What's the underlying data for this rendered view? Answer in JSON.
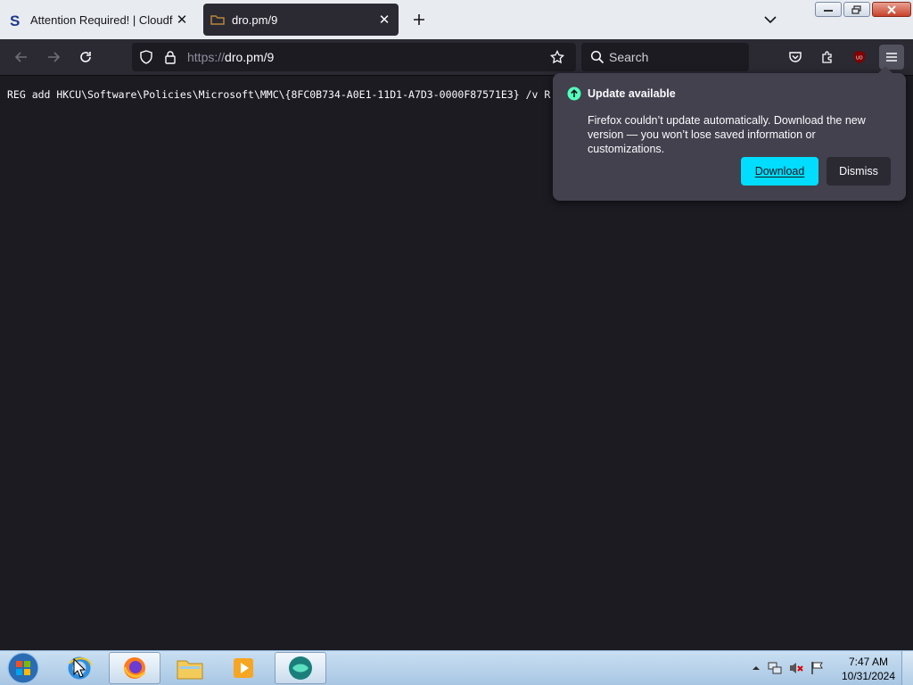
{
  "tabs": [
    {
      "title": "Attention Required! | Cloudflare",
      "active": false
    },
    {
      "title": "dro.pm/9",
      "active": true
    }
  ],
  "navbar": {
    "url_scheme": "https://",
    "url_host": "dro.pm/9",
    "search_placeholder": "Search"
  },
  "content": {
    "text": "REG add HKCU\\Software\\Policies\\Microsoft\\MMC\\{8FC0B734-A0E1-11D1-A7D3-0000F87571E3} /v R"
  },
  "update_panel": {
    "title": "Update available",
    "body": "Firefox couldn’t update automatically. Download the new version — you won’t lose saved information or customizations.",
    "download_label": "Download",
    "dismiss_label": "Dismiss",
    "accent_color": "#00ddff"
  },
  "taskbar": {
    "time": "7:47 AM",
    "date": "10/31/2024"
  },
  "icons": [
    "back-icon",
    "forward-icon",
    "reload-icon",
    "shield-icon",
    "lock-icon",
    "star-icon",
    "search-icon",
    "pocket-icon",
    "extensions-icon",
    "ublock-icon",
    "menu-icon",
    "update-arrow-icon"
  ]
}
